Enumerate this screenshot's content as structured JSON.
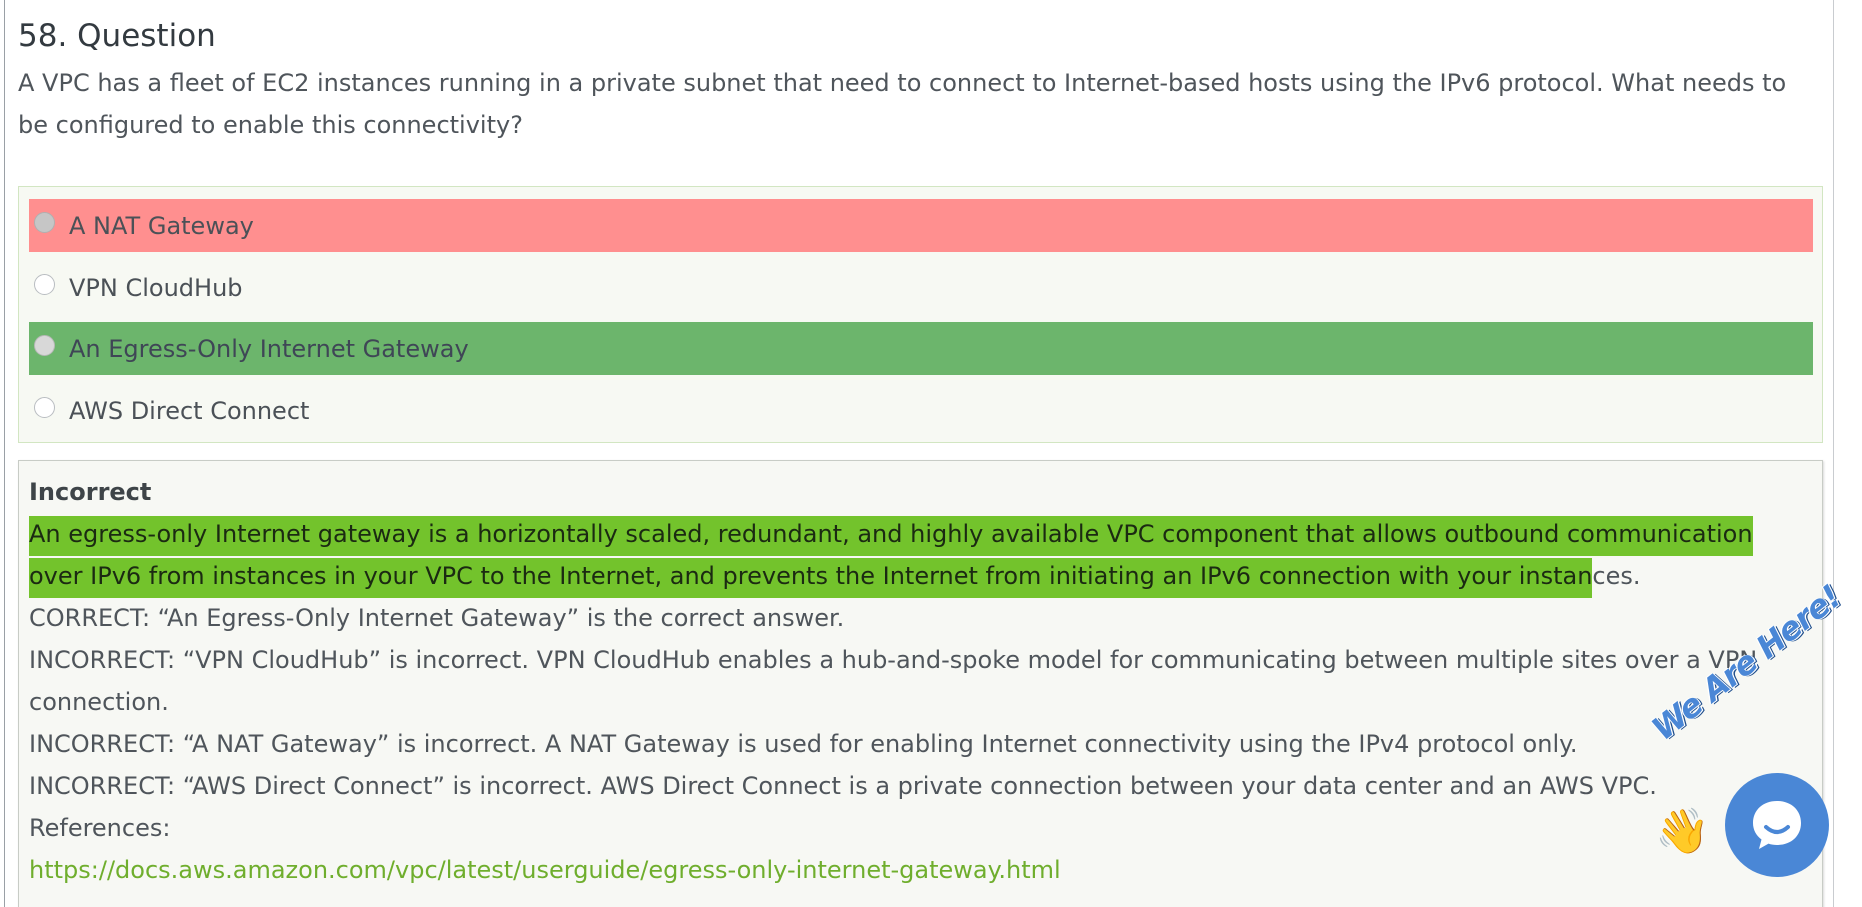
{
  "question": {
    "title": "58. Question",
    "text": "A VPC has a fleet of EC2 instances running in a private subnet that need to connect to Internet-based hosts using the IPv6 protocol. What needs to be configured to enable this connectivity?"
  },
  "options": [
    {
      "label": "A NAT Gateway",
      "state": "selected-incorrect"
    },
    {
      "label": "VPN CloudHub",
      "state": "unselected"
    },
    {
      "label": "An Egress-Only Internet Gateway",
      "state": "correct"
    },
    {
      "label": "AWS Direct Connect",
      "state": "unselected"
    }
  ],
  "explanation": {
    "result": "Incorrect",
    "highlighted": "An egress-only Internet gateway is a horizontally scaled, redundant, and highly available VPC component that allows outbound communication over IPv6 from instances in your VPC to the Internet, and prevents the Internet from initiating an IPv6 connection with your instan",
    "highlighted_rest": "ces.",
    "lines": [
      "CORRECT: “An Egress-Only Internet Gateway” is the correct answer.",
      "INCORRECT: “VPN CloudHub” is incorrect. VPN CloudHub enables a hub-and-spoke model for communicating between multiple sites over a VPN connection.",
      "INCORRECT: “A NAT Gateway” is incorrect. A NAT Gateway is used for enabling Internet connectivity using the IPv4 protocol only.",
      "INCORRECT: “AWS Direct Connect” is incorrect. AWS Direct Connect is a private connection between your data center and an AWS VPC."
    ],
    "references_label": "References:",
    "reference_url": "https://docs.aws.amazon.com/vpc/latest/userguide/egress-only-internet-gateway.html"
  },
  "chat_widget": {
    "badge_text": "We Are Here!",
    "wave_icon": "waving-hand-icon",
    "button_icon": "chat-bubble-icon"
  },
  "colors": {
    "wrong_option_bg": "#ff8f8f",
    "correct_option_bg": "#6cb56c",
    "text_highlight": "#73c32c",
    "link": "#6fae2d",
    "chat_accent": "#4a87d6"
  }
}
